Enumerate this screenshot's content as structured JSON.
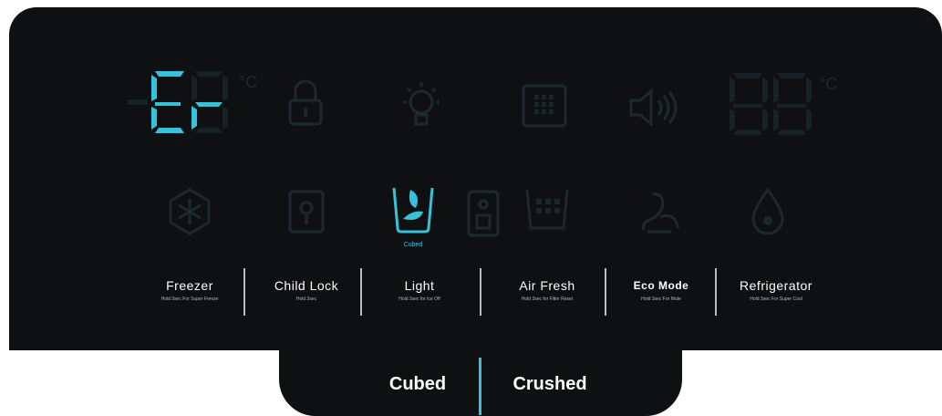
{
  "display": {
    "freezer_temp": "Er",
    "degree_symbol": "°C",
    "fridge_temp": "88"
  },
  "icons": {
    "lock": "lock-icon",
    "light": "light-bulb-icon",
    "filter": "filter-grid-icon",
    "sound": "speaker-icon",
    "super_freeze": "snowflake-hexagon-icon",
    "ice_cubed": "ice-cubed-icon",
    "ice_crushed": "ice-crushed-icon",
    "eco": "eco-plug-icon",
    "fresh": "water-drop-icon"
  },
  "indicators": {
    "cubed_label": "Cubed"
  },
  "buttons": [
    {
      "label": "Freezer",
      "sub": "Hold 3sec For Super Freeze"
    },
    {
      "label": "Child Lock",
      "sub": "Hold 3sec"
    },
    {
      "label": "Light",
      "sub": "Hold 3sec for Ice Off"
    },
    {
      "label": "Air Fresh",
      "sub": "Hold 3sec for Filter Reset"
    },
    {
      "label": "Eco Mode",
      "sub": "Hold 3sec For Mute"
    },
    {
      "label": "Refrigerator",
      "sub": "Hold 3sec For Super Cool"
    }
  ],
  "tray": {
    "left_label": "Cubed",
    "right_label": "Crushed"
  },
  "colors": {
    "panel": "#0f1012",
    "accent": "#35c3dc",
    "text": "#ffffff"
  }
}
